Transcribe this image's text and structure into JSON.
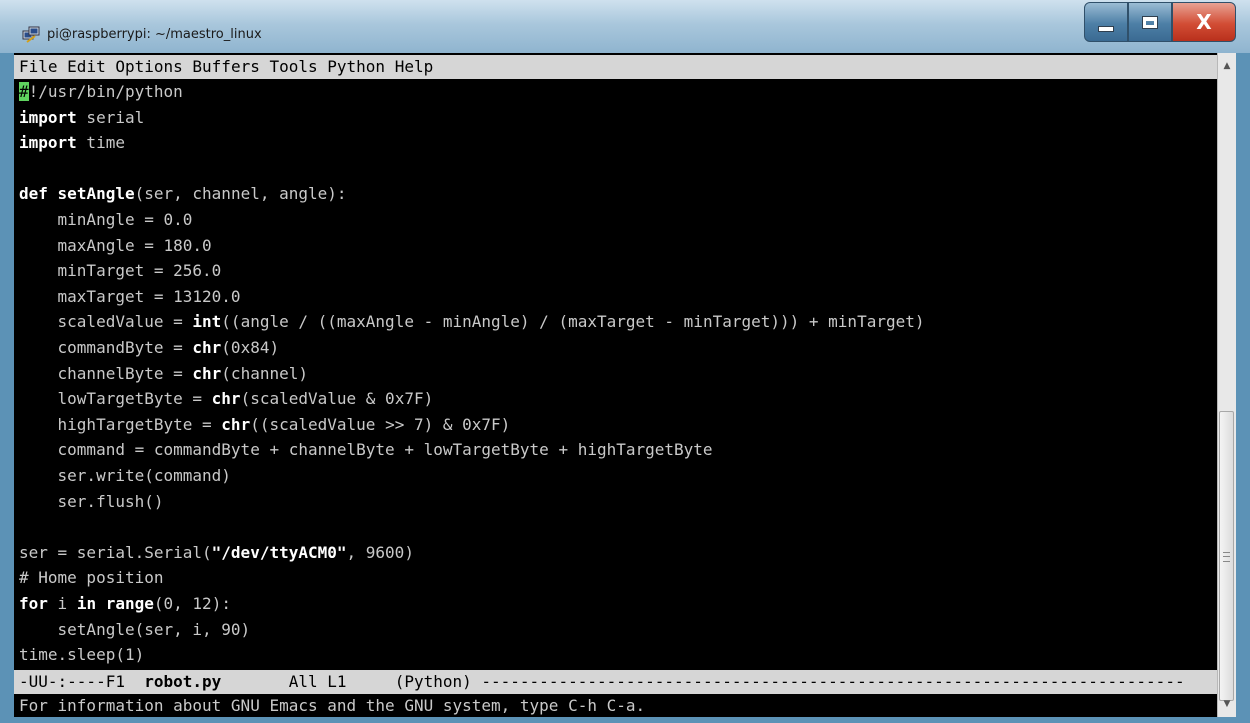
{
  "window": {
    "title": "pi@raspberrypi: ~/maestro_linux",
    "icon": "putty-terminal-icon",
    "controls": {
      "minimize": "minimize-icon",
      "maximize": "maximize-icon",
      "close": "X"
    }
  },
  "menubar": [
    "File",
    "Edit",
    "Options",
    "Buffers",
    "Tools",
    "Python",
    "Help"
  ],
  "buffer": {
    "lines": [
      [
        {
          "t": "#",
          "c": "cursor"
        },
        {
          "t": "!/usr/bin/python"
        }
      ],
      [
        {
          "t": "import",
          "c": "kw"
        },
        {
          "t": " serial"
        }
      ],
      [
        {
          "t": "import",
          "c": "kw"
        },
        {
          "t": " time"
        }
      ],
      [
        {
          "t": ""
        }
      ],
      [
        {
          "t": "def",
          "c": "kw"
        },
        {
          "t": " "
        },
        {
          "t": "setAngle",
          "c": "kw"
        },
        {
          "t": "(ser, channel, angle):"
        }
      ],
      [
        {
          "t": "    minAngle = 0.0"
        }
      ],
      [
        {
          "t": "    maxAngle = 180.0"
        }
      ],
      [
        {
          "t": "    minTarget = 256.0"
        }
      ],
      [
        {
          "t": "    maxTarget = 13120.0"
        }
      ],
      [
        {
          "t": "    scaledValue = "
        },
        {
          "t": "int",
          "c": "kw"
        },
        {
          "t": "((angle / ((maxAngle - minAngle) / (maxTarget - minTarget))) + minTarget)"
        }
      ],
      [
        {
          "t": "    commandByte = "
        },
        {
          "t": "chr",
          "c": "kw"
        },
        {
          "t": "(0x84)"
        }
      ],
      [
        {
          "t": "    channelByte = "
        },
        {
          "t": "chr",
          "c": "kw"
        },
        {
          "t": "(channel)"
        }
      ],
      [
        {
          "t": "    lowTargetByte = "
        },
        {
          "t": "chr",
          "c": "kw"
        },
        {
          "t": "(scaledValue & 0x7F)"
        }
      ],
      [
        {
          "t": "    highTargetByte = "
        },
        {
          "t": "chr",
          "c": "kw"
        },
        {
          "t": "((scaledValue >> 7) & 0x7F)"
        }
      ],
      [
        {
          "t": "    command = commandByte + channelByte + lowTargetByte + highTargetByte"
        }
      ],
      [
        {
          "t": "    ser.write(command)"
        }
      ],
      [
        {
          "t": "    ser.flush()"
        }
      ],
      [
        {
          "t": ""
        }
      ],
      [
        {
          "t": "ser = serial.Serial("
        },
        {
          "t": "\"/dev/ttyACM0\"",
          "c": "kw"
        },
        {
          "t": ", 9600)"
        }
      ],
      [
        {
          "t": "# Home position"
        }
      ],
      [
        {
          "t": "for",
          "c": "kw"
        },
        {
          "t": " i "
        },
        {
          "t": "in",
          "c": "kw"
        },
        {
          "t": " "
        },
        {
          "t": "range",
          "c": "kw"
        },
        {
          "t": "(0, 12):"
        }
      ],
      [
        {
          "t": "    setAngle(ser, i, 90)"
        }
      ],
      [
        {
          "t": "time.sleep(1)"
        }
      ]
    ]
  },
  "modeline": {
    "prefix": "-UU-:----F1  ",
    "filename": "robot.py",
    "rest": "       All L1     (Python) -------------------------------------------------------------------------"
  },
  "echo_area": "For information about GNU Emacs and the GNU system, type C-h C-a.",
  "colors": {
    "cursor": "#5fd35f",
    "background": "#000000",
    "text": "#c9c9c9",
    "bar": "#d6d6d6"
  }
}
